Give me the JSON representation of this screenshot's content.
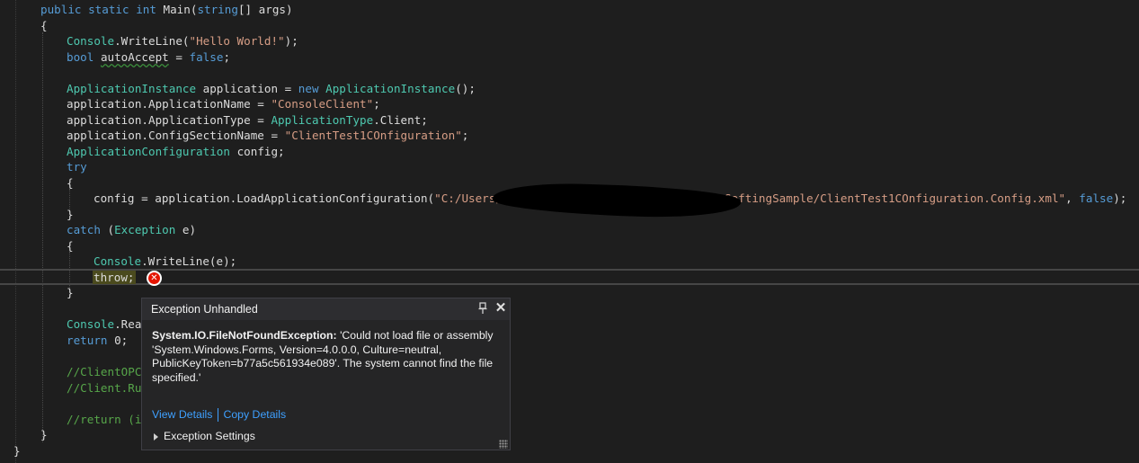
{
  "code": {
    "l1": {
      "a": "public",
      "b": " ",
      "c": "static",
      "d": " ",
      "e": "int",
      "f": " Main(",
      "g": "string",
      "h": "[] args)"
    },
    "l2": {
      "a": "{"
    },
    "l3": {
      "a": "Console",
      "b": ".WriteLine(",
      "c": "\"Hello World!\"",
      "d": ");"
    },
    "l4": {
      "a": "bool",
      "b": " ",
      "c": "autoAccept",
      "d": " = ",
      "e": "false",
      "f": ";"
    },
    "l5": {
      "a": "ApplicationInstance",
      "b": " application = ",
      "c": "new",
      "d": " ",
      "e": "ApplicationInstance",
      "f": "();"
    },
    "l6": {
      "a": "application.ApplicationName = ",
      "b": "\"ConsoleClient\"",
      "c": ";"
    },
    "l7": {
      "a": "application.ApplicationType = ",
      "b": "ApplicationType",
      "c": ".Client;"
    },
    "l8": {
      "a": "application.ConfigSectionName = ",
      "b": "\"ClientTest1COnfiguration\"",
      "c": ";"
    },
    "l9": {
      "a": "ApplicationConfiguration",
      "b": " config;"
    },
    "l10": {
      "a": "try"
    },
    "l11": {
      "a": "{"
    },
    "l12": {
      "a": "config = application.LoadApplicationConfiguration(",
      "b": "\"C:/Users/L",
      "c": "SoftingSample/ClientTest1COnfiguration.Config.xml\"",
      "d": ", ",
      "e": "false",
      "f": ");"
    },
    "l13": {
      "a": "}"
    },
    "l14": {
      "a": "catch",
      "b": " (",
      "c": "Exception",
      "d": " e)"
    },
    "l15": {
      "a": "{"
    },
    "l16": {
      "a": "Console",
      "b": ".WriteLine(e);"
    },
    "l17": {
      "a": "throw;"
    },
    "l18": {
      "a": "}"
    },
    "l19": {
      "a": "Console",
      "b": ".Rea"
    },
    "l20": {
      "a": "return",
      "b": " 0;"
    },
    "l21": {
      "a": "//ClientOPC"
    },
    "l22": {
      "a": "//Client.Ru"
    },
    "l23": {
      "a": "//return (i"
    },
    "l24": {
      "a": "}"
    },
    "l25": {
      "a": "}"
    }
  },
  "exception_popup": {
    "title": "Exception Unhandled",
    "exception_type": "System.IO.FileNotFoundException:",
    "message": " 'Could not load file or assembly 'System.Windows.Forms, Version=4.0.0.0, Culture=neutral, PublicKeyToken=b77a5c561934e089'. The system cannot find the file specified.'",
    "view_details": "View Details",
    "copy_details": "Copy Details",
    "exception_settings": "Exception Settings",
    "pin_icon": "pin-icon",
    "close_icon": "close-icon",
    "error_icon": "error-circle-icon"
  },
  "colors": {
    "background": "#1e1e1e",
    "keyword": "#569cd6",
    "type": "#4ec9b0",
    "string": "#d69d85",
    "comment": "#57a64a",
    "link": "#3ea0ff",
    "error": "#e51400"
  }
}
